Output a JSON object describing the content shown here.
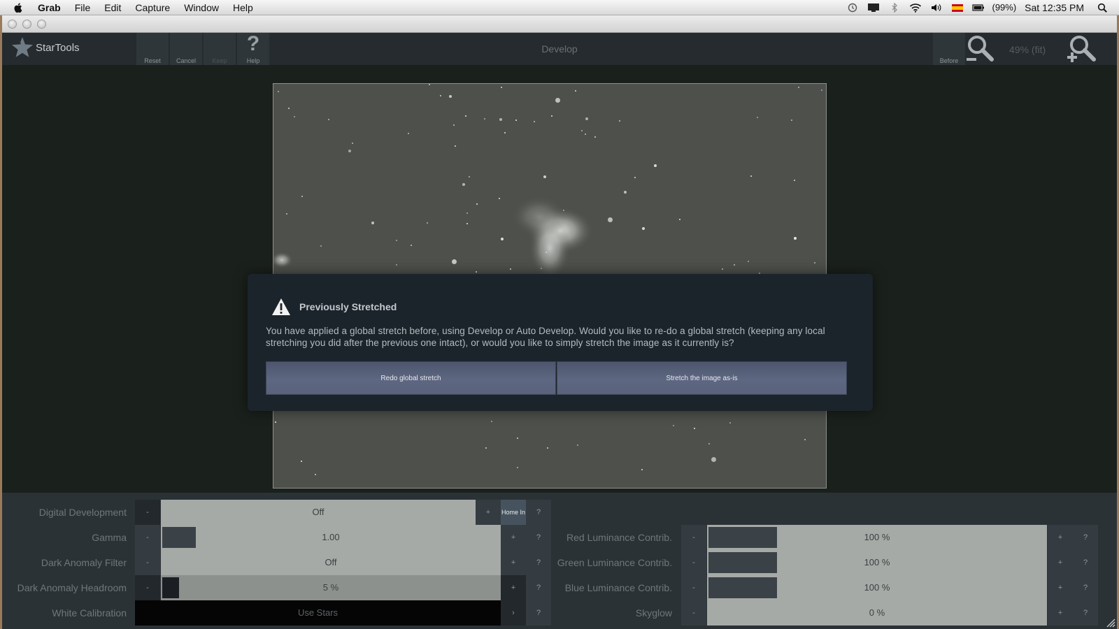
{
  "menubar": {
    "items": [
      "Grab",
      "File",
      "Edit",
      "Capture",
      "Window",
      "Help"
    ],
    "battery": "(99%)",
    "clock": "Sat 12:35 PM"
  },
  "toolbar": {
    "app_name": "StarTools",
    "buttons": {
      "reset": "Reset",
      "cancel": "Cancel",
      "keep": "Keep",
      "help": "Help"
    },
    "help_glyph": "?",
    "title": "Develop",
    "before": "Before",
    "zoom": "49% (fit)"
  },
  "modal": {
    "title": "Previously Stretched",
    "message": "You have applied a global stretch before, using Develop or Auto Develop. Would you like to re-do a global stretch (keeping any local stretching you did after the previous one intact), or would you like to simply stretch the image as it currently is?",
    "redo_label": "Redo global stretch",
    "asis_label": "Stretch the image as-is"
  },
  "params": {
    "minus": "-",
    "plus": "+",
    "help": "?",
    "home_in": "Home In",
    "arrow": "›",
    "left": [
      {
        "label": "Digital Development",
        "value": "Off"
      },
      {
        "label": "Gamma",
        "value": "1.00"
      },
      {
        "label": "Dark Anomaly Filter",
        "value": "Off"
      },
      {
        "label": "Dark Anomaly Headroom",
        "value": "5 %"
      },
      {
        "label": "White Calibration",
        "value": "Use Stars"
      }
    ],
    "right": [
      {
        "label": "Red Luminance Contrib.",
        "value": "100 %"
      },
      {
        "label": "Green Luminance Contrib.",
        "value": "100 %"
      },
      {
        "label": "Blue Luminance Contrib.",
        "value": "100 %"
      },
      {
        "label": "Skyglow",
        "value": "0 %"
      }
    ]
  },
  "colors": {
    "panel_bg": "#2b3236",
    "slider_bg": "#a6aaa6",
    "modal_bg": "#1c242b",
    "button_blue": "#5e6781"
  }
}
